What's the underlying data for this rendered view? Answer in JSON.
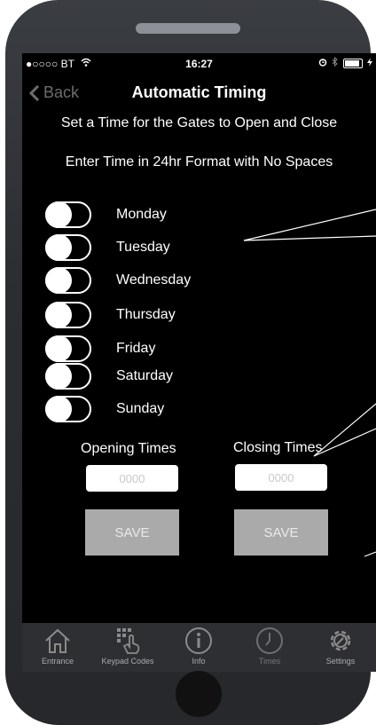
{
  "status_bar": {
    "carrier": "●○○○○ BT",
    "time": "16:27"
  },
  "nav": {
    "back_label": "Back",
    "title": "Automatic Timing"
  },
  "instructions": {
    "line1": "Set a Time for the Gates to Open and Close",
    "line2": "Enter Time in 24hr Format with No Spaces"
  },
  "days": [
    {
      "label": "Monday",
      "on": false
    },
    {
      "label": "Tuesday",
      "on": false
    },
    {
      "label": "Wednesday",
      "on": false
    },
    {
      "label": "Thursday",
      "on": false
    },
    {
      "label": "Friday",
      "on": false
    },
    {
      "label": "Saturday",
      "on": false
    },
    {
      "label": "Sunday",
      "on": false
    }
  ],
  "opening": {
    "label": "Opening Times",
    "placeholder": "0000",
    "value": "",
    "save_label": "SAVE"
  },
  "closing": {
    "label": "Closing Times",
    "placeholder": "0000",
    "value": "",
    "save_label": "SAVE"
  },
  "tabs": [
    {
      "label": "Entrance",
      "icon": "home-icon"
    },
    {
      "label": "Keypad Codes",
      "icon": "keypad-icon"
    },
    {
      "label": "Info",
      "icon": "info-icon"
    },
    {
      "label": "Times",
      "icon": "clock-icon"
    },
    {
      "label": "Settings",
      "icon": "gear-icon"
    }
  ],
  "colors": {
    "screen_bg": "#000000",
    "save_button": "#aaaaaa",
    "tab_bar": "#2e2f32",
    "phone_body": "#2b2d31"
  }
}
